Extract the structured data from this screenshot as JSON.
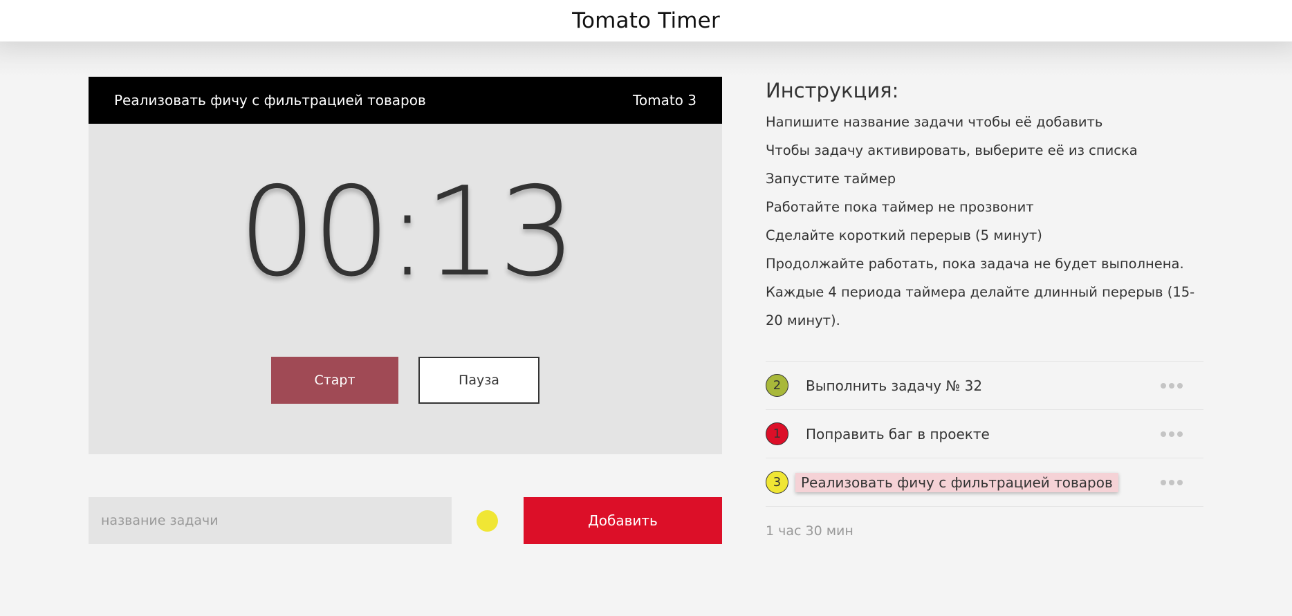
{
  "header": {
    "title": "Tomato Timer"
  },
  "timer": {
    "current_task": "Реализовать фичу с фильтрацией товаров",
    "tomato_label": "Tomato 3",
    "time": "00:13",
    "start_label": "Старт",
    "pause_label": "Пауза",
    "colors": {
      "header_bg": "#000000",
      "body_bg": "#e4e4e4",
      "start_bg": "#a04a55"
    }
  },
  "form": {
    "placeholder": "название задачи",
    "value": "",
    "priority_color": "#f0e634",
    "add_label": "Добавить",
    "add_color": "#dc0f28"
  },
  "instructions": {
    "title": "Инструкция:",
    "items": [
      "Напишите название задачи чтобы её добавить",
      "Чтобы задачу активировать, выберите её из списка",
      "Запустите таймер",
      "Работайте пока таймер не прозвонит",
      "Сделайте короткий перерыв (5 минут)",
      "Продолжайте работать, пока задача не будет выполнена.",
      "Каждые 4 периода таймера делайте длинный перерыв (15-20 минут)."
    ]
  },
  "tasks": [
    {
      "count": "2",
      "name": "Выполнить задачу № 32",
      "color": "#a8b83a",
      "active": false,
      "menu_icon": "more-dots-icon"
    },
    {
      "count": "1",
      "name": "Поправить баг в проекте",
      "color": "#dc0f28",
      "active": false,
      "menu_icon": "more-dots-icon"
    },
    {
      "count": "3",
      "name": "Реализовать фичу с фильтрацией товаров",
      "color": "#f0e634",
      "active": true,
      "menu_icon": "more-dots-icon"
    }
  ],
  "total_time": "1 час 30 мин"
}
